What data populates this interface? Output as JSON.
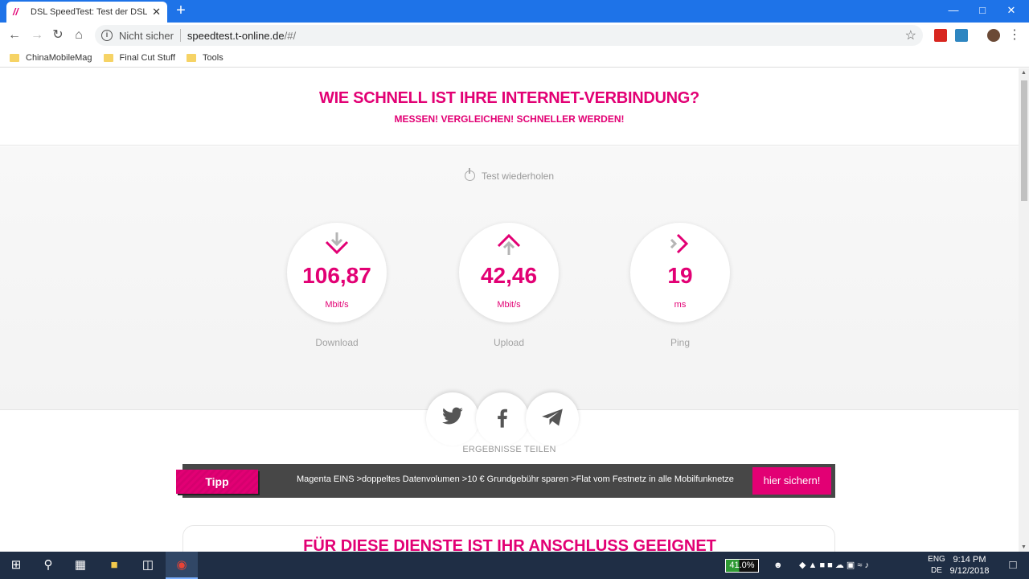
{
  "browser": {
    "tab_title": "DSL SpeedTest: Test der DSL-Ges",
    "tab_close": "✕",
    "new_tab": "+",
    "security_label": "Nicht sicher",
    "url_host": "speedtest.t-online.de",
    "url_path": "/#/",
    "bookmarks": [
      "ChinaMobileMag",
      "Final Cut Stuff",
      "Tools"
    ]
  },
  "hero": {
    "title": "WIE SCHNELL IST IHRE INTERNET-VERBINDUNG?",
    "subtitle": "MESSEN! VERGLEICHEN! SCHNELLER WERDEN!"
  },
  "results": {
    "retest_label": "Test wiederholen",
    "metrics": [
      {
        "value": "106,87",
        "unit": "Mbit/s",
        "label": "Download",
        "icon": "download-arrow-icon"
      },
      {
        "value": "42,46",
        "unit": "Mbit/s",
        "label": "Upload",
        "icon": "upload-arrow-icon"
      },
      {
        "value": "19",
        "unit": "ms",
        "label": "Ping",
        "icon": "ping-arrow-icon"
      }
    ]
  },
  "share": {
    "label": "ERGEBNISSE TEILEN",
    "buttons": [
      "twitter-icon",
      "facebook-icon",
      "telegram-icon"
    ]
  },
  "banner": {
    "tag": "Tipp",
    "text": "Magenta EINS >doppeltes Datenvolumen >10 € Grundgebühr sparen >Flat vom Festnetz in alle Mobilfunknetze",
    "cta": "hier sichern!"
  },
  "section": {
    "title": "FÜR DIESE DIENSTE IST IHR ANSCHLUSS GEEIGNET"
  },
  "taskbar": {
    "battery": "41.0%",
    "lang_top": "ENG",
    "lang_bottom": "DE",
    "time": "9:14 PM",
    "date": "9/12/2018"
  },
  "colors": {
    "accent": "#e20074",
    "titlebar": "#1e73e8",
    "taskbar": "#1f2e45"
  }
}
